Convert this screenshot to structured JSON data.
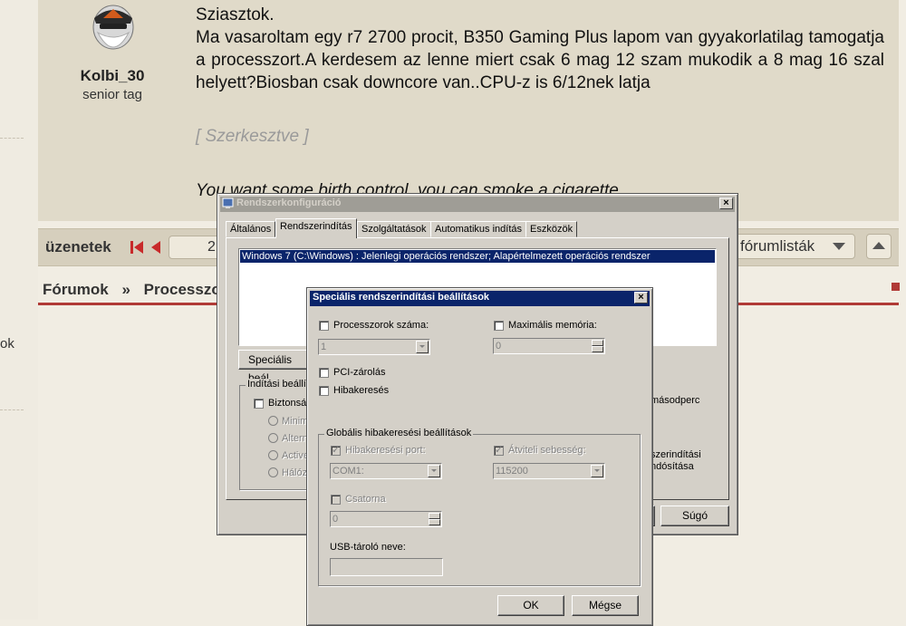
{
  "forum": {
    "user": {
      "name": "Kolbi_30",
      "rank": "senior tag"
    },
    "post": {
      "lines": [
        "Sziasztok.",
        "Ma vasaroltam egy r7 2700 procit, B350 Gaming Plus lapom van gyyakorlatilag tamogatja a processzort.A kerdesem az lenne miert csak 6 mag 12 szam mukodik a 8 mag 16 szal helyett?Biosban csak downcore van..CPU-z is 6/12nek latja"
      ],
      "edited": "[ Szerkesztve ]",
      "signature": "You want some birth control, you can smoke a cigarette"
    },
    "side_text": "ok",
    "nav": {
      "label": "üzenetek",
      "page": "2",
      "forum_lists": "fórumlisták"
    },
    "breadcrumb": {
      "home": "Fórumok",
      "sep": "»",
      "current": "Processzo"
    }
  },
  "syscfg": {
    "title": "Rendszerkonfiguráció",
    "tabs": [
      "Általános",
      "Rendszerindítás",
      "Szolgáltatások",
      "Automatikus indítás",
      "Eszközök"
    ],
    "active_tab": "Rendszerindítás",
    "boot_entries": [
      "Windows 7 (C:\\Windows) : Jelenlegi operációs rendszer; Alapértelmezett operációs rendszer"
    ],
    "advanced_button": "Speciális beál",
    "boot_options_group": "Indítási beállít",
    "safe_boot": "Biztonsá",
    "radios": [
      "Minim",
      "Altern",
      "Active",
      "Hálóz"
    ],
    "timeout_unit": "másodperc",
    "permanent_line1": "szerindítási",
    "permanent_line2": "ndósítása",
    "help_button": "Súgó"
  },
  "advanced": {
    "title": "Speciális rendszerindítási beállítások",
    "num_processors_label": "Processzorok száma:",
    "num_processors_value": "1",
    "max_memory_label": "Maximális memória:",
    "max_memory_value": "0",
    "pci_lock": "PCI-zárolás",
    "debug": "Hibakeresés",
    "global_group": "Globális hibakeresési beállítások",
    "debug_port_label": "Hibakeresési port:",
    "debug_port_value": "COM1:",
    "baud_label": "Átviteli sebesség:",
    "baud_value": "115200",
    "channel_label": "Csatorna",
    "channel_value": "0",
    "usb_label": "USB-tároló neve:",
    "ok": "OK",
    "cancel": "Mégse"
  }
}
